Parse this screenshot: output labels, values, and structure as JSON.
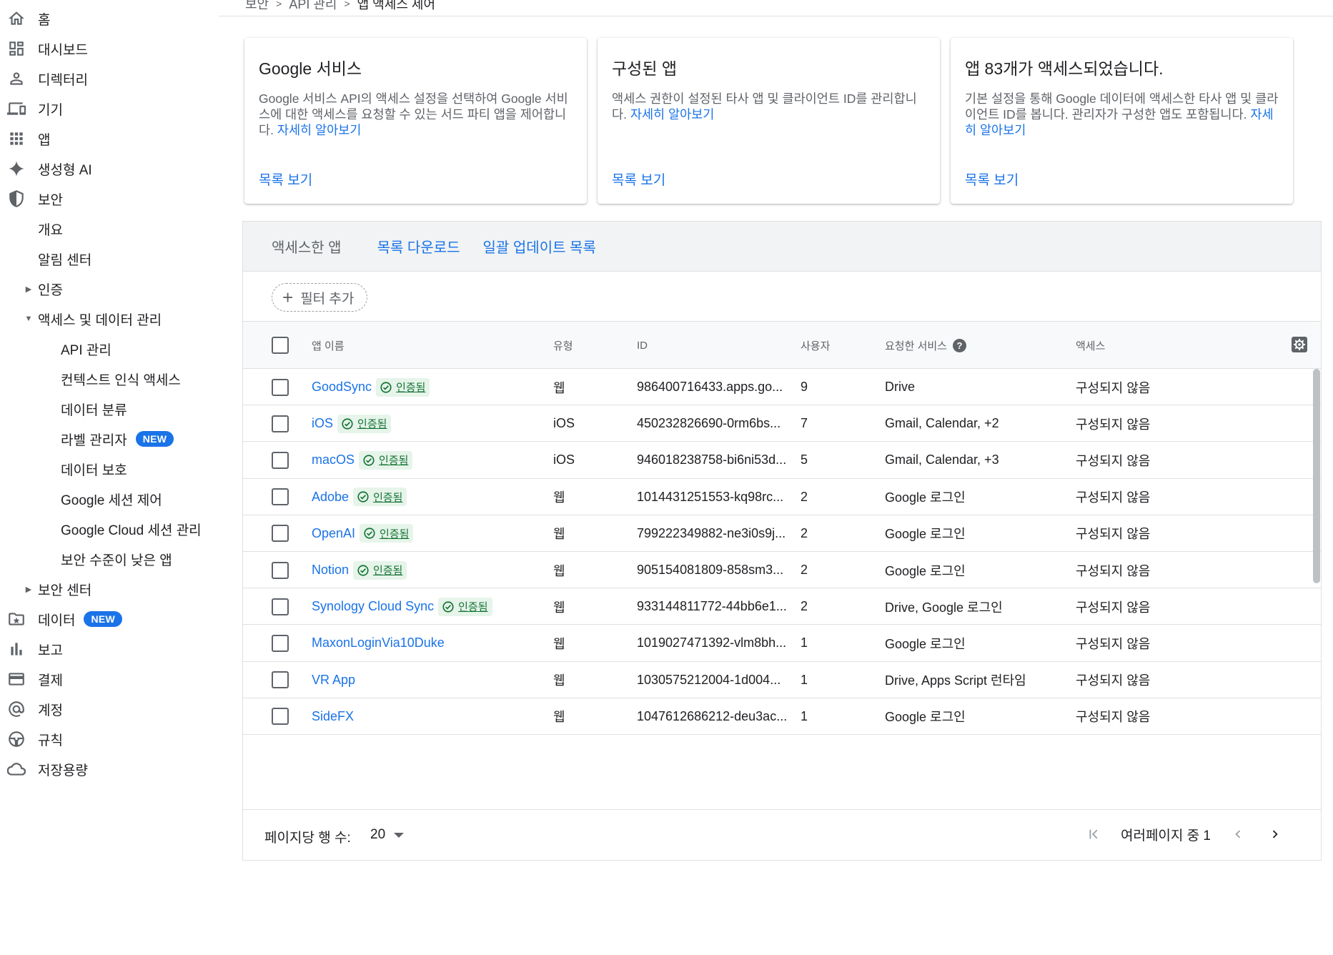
{
  "breadcrumb": {
    "items": [
      "보안",
      "API 관리",
      "앱 액세스 제어"
    ]
  },
  "sidebar": {
    "items": [
      {
        "label": "홈",
        "icon": "home-icon"
      },
      {
        "label": "대시보드",
        "icon": "dashboard-icon"
      },
      {
        "label": "디렉터리",
        "icon": "person-icon"
      },
      {
        "label": "기기",
        "icon": "devices-icon"
      },
      {
        "label": "앱",
        "icon": "apps-grid-icon"
      },
      {
        "label": "생성형 AI",
        "icon": "sparkle-icon"
      },
      {
        "label": "보안",
        "icon": "shield-icon"
      }
    ],
    "security_sub": {
      "overview": "개요",
      "alert_center": "알림 센터",
      "auth": "인증",
      "access_data": "액세스 및 데이터 관리",
      "api": "API 관리",
      "context": "컨텍스트 인식 액세스",
      "classification": "데이터 분류",
      "label_manager": "라벨 관리자",
      "data_protection": "데이터 보호",
      "google_session": "Google 세션 제어",
      "cloud_session": "Google Cloud 세션 관리",
      "less_secure": "보안 수준이 낮은 앱",
      "security_center": "보안 센터"
    },
    "bottom_items": [
      {
        "label": "데이터",
        "icon": "folder-star-icon"
      },
      {
        "label": "보고",
        "icon": "bar-chart-icon"
      },
      {
        "label": "결제",
        "icon": "credit-card-icon"
      },
      {
        "label": "계정",
        "icon": "at-sign-icon"
      },
      {
        "label": "규칙",
        "icon": "steering-icon"
      },
      {
        "label": "저장용량",
        "icon": "cloud-icon"
      }
    ],
    "new_badge": "NEW"
  },
  "cards": [
    {
      "title": "Google 서비스",
      "desc": "Google 서비스 API의 액세스 설정을 선택하여 Google 서비스에 대한 액세스를 요청할 수 있는 서드 파티 앱을 제어합니다.",
      "learn_more": "자세히 알아보기",
      "action": "목록 보기"
    },
    {
      "title": "구성된 앱",
      "desc": "액세스 권한이 설정된 타사 앱 및 클라이언트 ID를 관리합니다.",
      "learn_more": "자세히 알아보기",
      "action": "목록 보기"
    },
    {
      "title": "앱 83개가 액세스되었습니다.",
      "desc": "기본 설정을 통해 Google 데이터에 액세스한 타사 앱 및 클라이언트 ID를 봅니다. 관리자가 구성한 앱도 포함됩니다.",
      "learn_more": "자세히 알아보기",
      "action": "목록 보기"
    }
  ],
  "table": {
    "title": "액세스한 앱",
    "download": "목록 다운로드",
    "bulk_update": "일괄 업데이트 목록",
    "add_filter": "필터 추가",
    "columns": {
      "name": "앱 이름",
      "type": "유형",
      "id": "ID",
      "users": "사용자",
      "services": "요청한 서비스",
      "access": "액세스"
    },
    "verified_label": "인증됨",
    "rows": [
      {
        "name": "GoodSync",
        "verified": true,
        "type": "웹",
        "id": "986400716433.apps.go...",
        "users": "9",
        "services": "Drive",
        "access": "구성되지 않음"
      },
      {
        "name": "iOS",
        "verified": true,
        "type": "iOS",
        "id": "450232826690-0rm6bs...",
        "users": "7",
        "services": "Gmail, Calendar, +2",
        "access": "구성되지 않음"
      },
      {
        "name": "macOS",
        "verified": true,
        "type": "iOS",
        "id": "946018238758-bi6ni53d...",
        "users": "5",
        "services": "Gmail, Calendar, +3",
        "access": "구성되지 않음"
      },
      {
        "name": "Adobe",
        "verified": true,
        "type": "웹",
        "id": "1014431251553-kq98rc...",
        "users": "2",
        "services": "Google 로그인",
        "access": "구성되지 않음"
      },
      {
        "name": "OpenAI",
        "verified": true,
        "type": "웹",
        "id": "799222349882-ne3i0s9j...",
        "users": "2",
        "services": "Google 로그인",
        "access": "구성되지 않음"
      },
      {
        "name": "Notion",
        "verified": true,
        "type": "웹",
        "id": "905154081809-858sm3...",
        "users": "2",
        "services": "Google 로그인",
        "access": "구성되지 않음"
      },
      {
        "name": "Synology Cloud Sync",
        "verified": true,
        "type": "웹",
        "id": "933144811772-44bb6e1...",
        "users": "2",
        "services": "Drive, Google 로그인",
        "access": "구성되지 않음"
      },
      {
        "name": "MaxonLoginVia10Duke",
        "verified": false,
        "type": "웹",
        "id": "1019027471392-vlm8bh...",
        "users": "1",
        "services": "Google 로그인",
        "access": "구성되지 않음"
      },
      {
        "name": "VR App",
        "verified": false,
        "type": "웹",
        "id": "1030575212004-1d004...",
        "users": "1",
        "services": "Drive, Apps Script 런타임",
        "access": "구성되지 않음"
      },
      {
        "name": "SideFX",
        "verified": false,
        "type": "웹",
        "id": "1047612686212-deu3ac...",
        "users": "1",
        "services": "Google 로그인",
        "access": "구성되지 않음"
      }
    ],
    "footer": {
      "rows_per_page_label": "페이지당 행 수:",
      "rows_per_page": "20",
      "page_info": "여러페이지 중 1"
    }
  },
  "colors": {
    "accent": "#1a73e8",
    "verified_bg": "#e6f4ea",
    "verified_fg": "#137333",
    "header_bg": "#f1f3f4"
  }
}
